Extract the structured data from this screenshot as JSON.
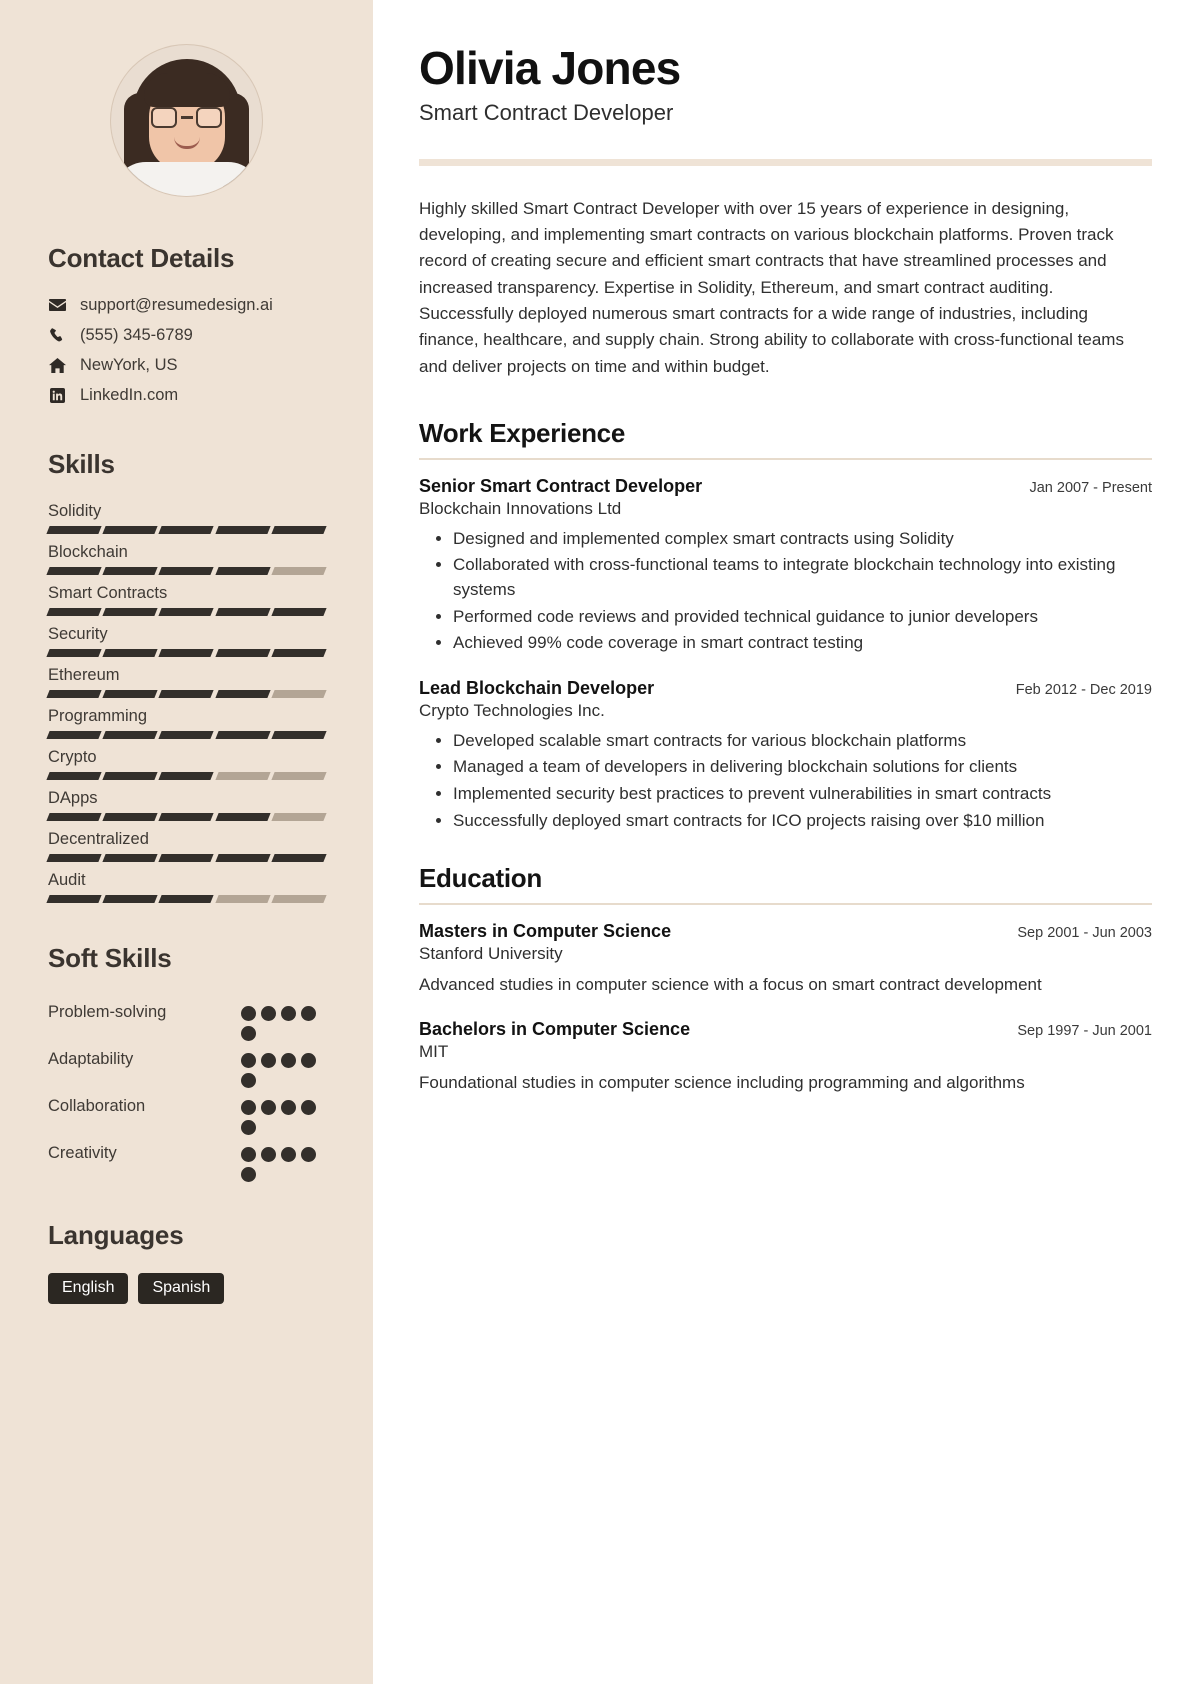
{
  "header": {
    "name": "Olivia Jones",
    "role": "Smart Contract Developer"
  },
  "summary": "Highly skilled Smart Contract Developer with over 15 years of experience in designing, developing, and implementing smart contracts on various blockchain platforms. Proven track record of creating secure and efficient smart contracts that have streamlined processes and increased transparency. Expertise in Solidity, Ethereum, and smart contract auditing. Successfully deployed numerous smart contracts for a wide range of industries, including finance, healthcare, and supply chain. Strong ability to collaborate with cross-functional teams and deliver projects on time and within budget.",
  "sidebar": {
    "contact": {
      "title": "Contact Details",
      "items": [
        {
          "icon": "email-icon",
          "value": "support@resumedesign.ai"
        },
        {
          "icon": "phone-icon",
          "value": "(555) 345-6789"
        },
        {
          "icon": "home-icon",
          "value": "NewYork, US"
        },
        {
          "icon": "linkedin-icon",
          "value": "LinkedIn.com"
        }
      ]
    },
    "skills": {
      "title": "Skills",
      "max": 5,
      "items": [
        {
          "label": "Solidity",
          "level": 5
        },
        {
          "label": "Blockchain",
          "level": 4
        },
        {
          "label": "Smart Contracts",
          "level": 5
        },
        {
          "label": "Security",
          "level": 5
        },
        {
          "label": "Ethereum",
          "level": 4
        },
        {
          "label": "Programming",
          "level": 5
        },
        {
          "label": "Crypto",
          "level": 3
        },
        {
          "label": "DApps",
          "level": 4
        },
        {
          "label": "Decentralized",
          "level": 5
        },
        {
          "label": "Audit",
          "level": 3
        }
      ]
    },
    "soft_skills": {
      "title": "Soft Skills",
      "max": 5,
      "items": [
        {
          "label": "Problem-solving",
          "level": 5
        },
        {
          "label": "Adaptability",
          "level": 5
        },
        {
          "label": "Collaboration",
          "level": 5
        },
        {
          "label": "Creativity",
          "level": 5
        }
      ]
    },
    "languages": {
      "title": "Languages",
      "items": [
        "English",
        "Spanish"
      ]
    }
  },
  "main": {
    "work": {
      "title": "Work Experience",
      "entries": [
        {
          "role": "Senior Smart Contract Developer",
          "date": "Jan 2007 - Present",
          "org": "Blockchain Innovations Ltd",
          "bullets": [
            "Designed and implemented complex smart contracts using Solidity",
            "Collaborated with cross-functional teams to integrate blockchain technology into existing systems",
            "Performed code reviews and provided technical guidance to junior developers",
            "Achieved 99% code coverage in smart contract testing"
          ]
        },
        {
          "role": "Lead Blockchain Developer",
          "date": "Feb 2012 - Dec 2019",
          "org": "Crypto Technologies Inc.",
          "bullets": [
            "Developed scalable smart contracts for various blockchain platforms",
            "Managed a team of developers in delivering blockchain solutions for clients",
            "Implemented security best practices to prevent vulnerabilities in smart contracts",
            "Successfully deployed smart contracts for ICO projects raising over $10 million"
          ]
        }
      ]
    },
    "education": {
      "title": "Education",
      "entries": [
        {
          "degree": "Masters in Computer Science",
          "date": "Sep 2001 - Jun 2003",
          "school": "Stanford University",
          "description": "Advanced studies in computer science with a focus on smart contract development"
        },
        {
          "degree": "Bachelors in Computer Science",
          "date": "Sep 1997 - Jun 2001",
          "school": "MIT",
          "description": "Foundational studies in computer science including programming and algorithms"
        }
      ]
    }
  },
  "colors": {
    "sidebar_bg": "#efe3d6",
    "ink": "#332f2b",
    "muted_bar": "#b3a595",
    "tag_bg": "#2b2722"
  }
}
